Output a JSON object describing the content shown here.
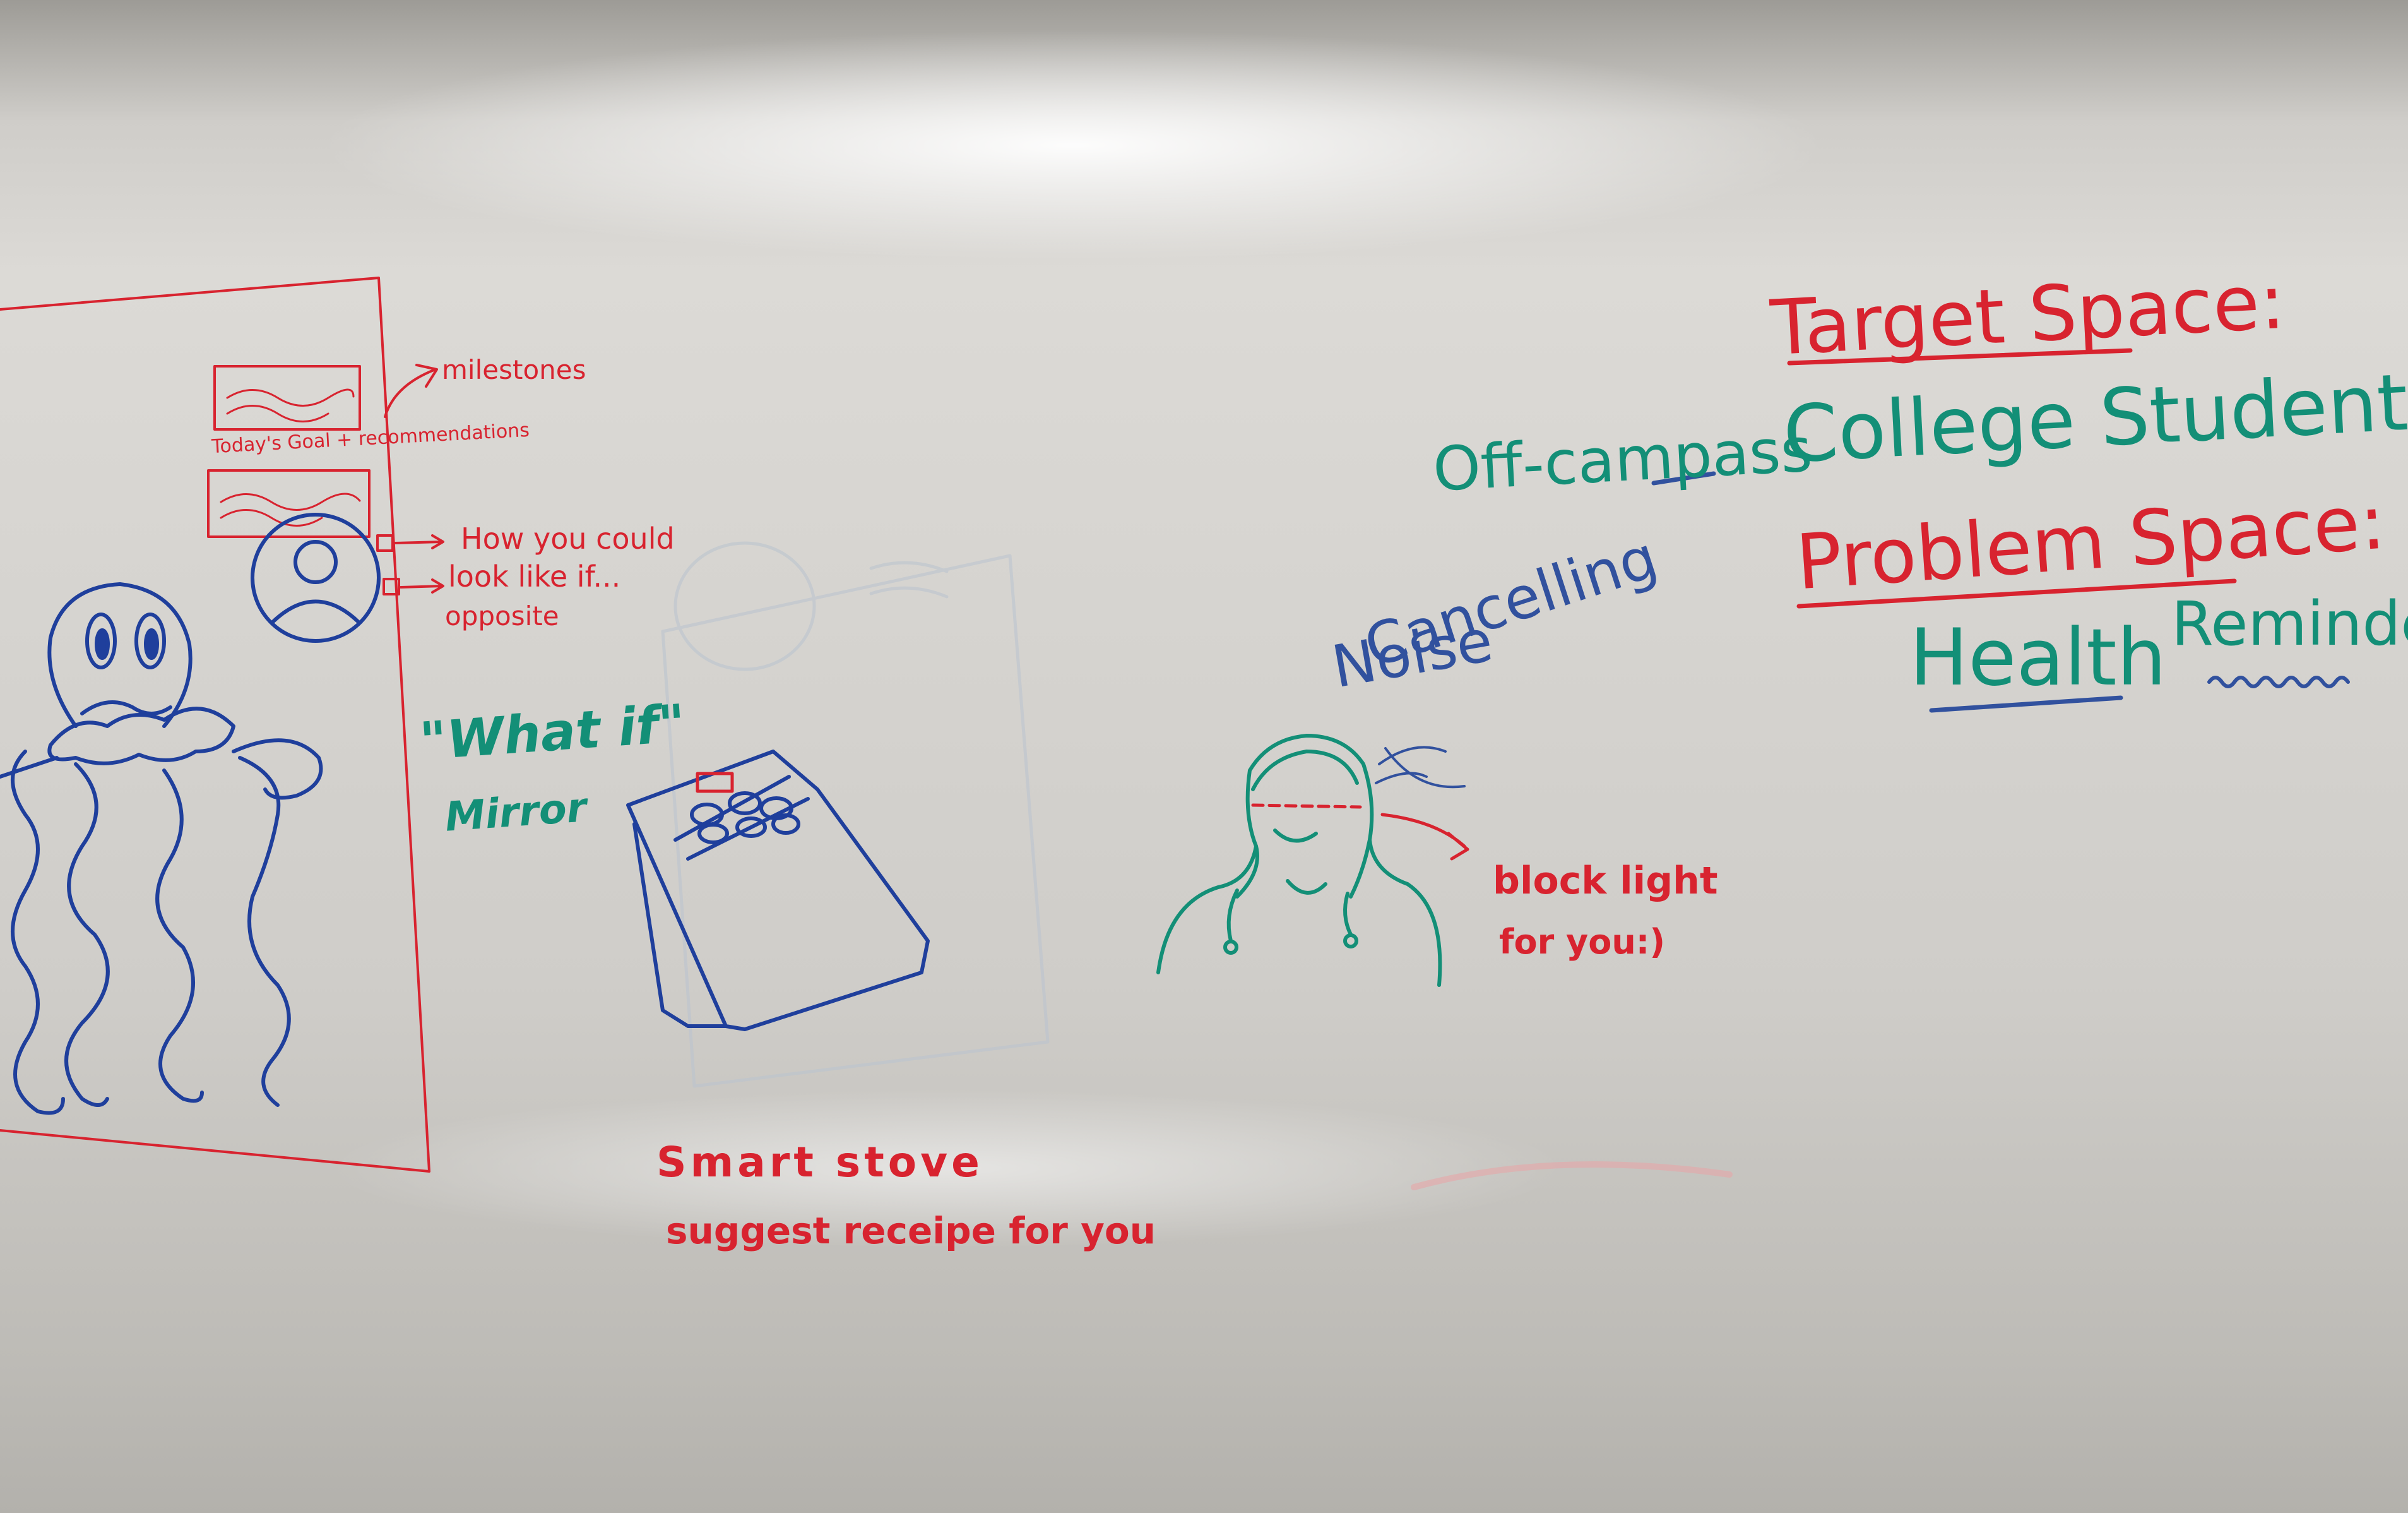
{
  "scene": "whiteboard",
  "marker_colors": {
    "red": "#d8232f",
    "green": "#138f77",
    "blue": "#31519e"
  },
  "notes": {
    "milestones": "milestones",
    "todays_goal": "Today's Goal + recommendations",
    "how_you_could": "How you could",
    "look_like_if": "look like if...",
    "opposite": "opposite",
    "what_if": "\"What if\"",
    "mirror": "Mirror",
    "smart_stove": "Smart stove",
    "suggest_receipe": "suggest receipe for you",
    "noise_cancelling_1": "Noise",
    "noise_cancelling_2": "Cancelling",
    "block_light_1": "block light",
    "block_light_2": "for you:)",
    "target_space": "Target Space:",
    "off_campass": "Off-campass",
    "college_students": "College Students",
    "problem_space": "Problem Space:",
    "health": "Health",
    "reminders": "Reminders"
  }
}
